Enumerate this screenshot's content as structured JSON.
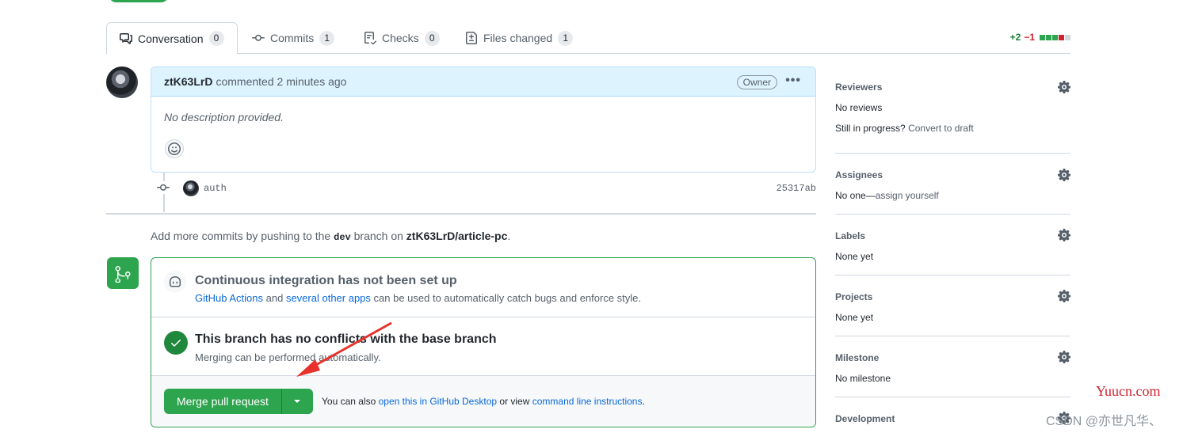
{
  "tabs": [
    {
      "label": "Conversation",
      "count": "0",
      "icon": "conversation-icon"
    },
    {
      "label": "Commits",
      "count": "1",
      "icon": "commit-icon"
    },
    {
      "label": "Checks",
      "count": "0",
      "icon": "checklist-icon"
    },
    {
      "label": "Files changed",
      "count": "1",
      "icon": "file-diff-icon"
    }
  ],
  "diffstat": {
    "additions": "+2",
    "deletions": "−1",
    "colors": [
      "#2da44e",
      "#2da44e",
      "#2da44e",
      "#cf222e",
      "#d0d7de"
    ]
  },
  "comment": {
    "author": "ztK63LrD",
    "action": "commented",
    "time": "2 minutes ago",
    "badge": "Owner",
    "body": "No description provided."
  },
  "commit": {
    "message": "auth",
    "sha": "25317ab"
  },
  "push_hint": {
    "prefix": "Add more commits by pushing to the",
    "branch": "dev",
    "middle": "branch on",
    "repo": "ztK63LrD/article-pc",
    "suffix": "."
  },
  "merge": {
    "ci_title": "Continuous integration has not been set up",
    "ci_link1": "GitHub Actions",
    "ci_and": "and",
    "ci_link2": "several other apps",
    "ci_rest": "can be used to automatically catch bugs and enforce style.",
    "conflict_title": "This branch has no conflicts with the base branch",
    "conflict_desc": "Merging can be performed automatically.",
    "button": "Merge pull request",
    "also_prefix": "You can also",
    "also_link1": "open this in GitHub Desktop",
    "also_middle": "or view",
    "also_link2": "command line instructions",
    "also_suffix": "."
  },
  "sidebar": {
    "reviewers": {
      "title": "Reviewers",
      "value": "No reviews",
      "sub_prefix": "Still in progress?",
      "sub_link": "Convert to draft"
    },
    "assignees": {
      "title": "Assignees",
      "value_prefix": "No one—",
      "value_link": "assign yourself"
    },
    "labels": {
      "title": "Labels",
      "value": "None yet"
    },
    "projects": {
      "title": "Projects",
      "value": "None yet"
    },
    "milestone": {
      "title": "Milestone",
      "value": "No milestone"
    },
    "development": {
      "title": "Development"
    }
  },
  "watermark": {
    "site": "Yuucn.com",
    "csdn": "CSDN @亦世凡华、"
  }
}
